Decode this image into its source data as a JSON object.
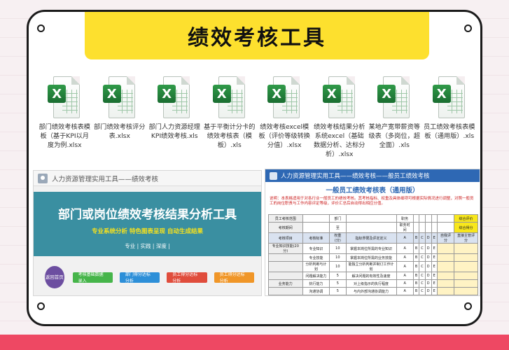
{
  "page": {
    "title": "绩效考核工具"
  },
  "files": [
    {
      "icon": "excel-file-icon",
      "name": "部门绩效考核表模板（基于KPI以月度为例.xlsx"
    },
    {
      "icon": "excel-file-icon",
      "name": "部门绩效考核评分表.xlsx"
    },
    {
      "icon": "excel-file-icon",
      "name": "部门人力资源经理KPI绩效考核.xls"
    },
    {
      "icon": "excel-file-icon",
      "name": "基于平衡计分卡的绩效考核表（模板）.xls"
    },
    {
      "icon": "excel-file-icon",
      "name": "绩效考核excel模板（评价等级转换分值）.xlsx"
    },
    {
      "icon": "excel-file-icon",
      "name": "绩效考核结果分析系统excel（基础数据分析、达标分析）.xlsx"
    },
    {
      "icon": "excel-file-icon",
      "name": "某地产宽带薪资等级表（多岗位，超全面）.xls"
    },
    {
      "icon": "excel-file-icon",
      "name": "员工绩效考核表模板（通用版）.xls"
    }
  ],
  "preview_left": {
    "header": "人力资源管理实用工具——绩效考核",
    "title": "部门或岗位绩效考核结果分析工具",
    "subtitle": "专业系统分析   特色图表呈现   自动生成结果",
    "motto": "专业 | 实践 | 深度 |",
    "home_button": "返回首页",
    "buttons": [
      "考核基础数据录入",
      "部门得分达标分析",
      "员工得分达标分析",
      "员工得分达标分析"
    ]
  },
  "preview_right": {
    "header": "人力资源管理实用工具——绩效考核——般员工绩效考核",
    "table_title": "一般员工绩效考核表（通用版）",
    "description": "说明：本表格适用于对各行业一般员工的绩效考核。其考核指标、权重及具体细项可根据实际情况进行调整，对照一般员工的岗位职责与工作内容评定等级，评价汇总后自动得出相应分值。",
    "rows": [
      [
        "员工考核范围",
        "",
        "部门",
        "",
        "职务",
        "",
        "",
        "",
        "",
        "",
        "综合评价"
      ],
      [
        "考核期间",
        "",
        "至",
        "",
        "职务时间",
        "",
        "",
        "",
        "",
        "",
        "综合得分"
      ],
      [
        "考核项目",
        "考核标准",
        "权重(分)",
        "指标界限及评定定义",
        "A",
        "B",
        "C",
        "D",
        "E",
        "自我评分",
        "直接主管评分"
      ],
      [
        "专业知识技能(20分)",
        "专业知识",
        "10",
        "掌握本岗位所需的专业知识",
        "A",
        "B",
        "C",
        "D",
        "E",
        "",
        ""
      ],
      [
        "",
        "专业技能",
        "10",
        "掌握本岗位所需的业务技能",
        "A",
        "B",
        "C",
        "D",
        "E",
        "",
        ""
      ],
      [
        "",
        "分析判断与计划",
        "10",
        "能独立分析判断并制订工作计划",
        "A",
        "B",
        "C",
        "D",
        "E",
        "",
        ""
      ],
      [
        "",
        "问题解决能力",
        "5",
        "解决问题的有效性及速度",
        "A",
        "B",
        "C",
        "D",
        "E",
        "",
        ""
      ],
      [
        "业务能力",
        "执行能力",
        "5",
        "对上级指示的执行程度",
        "A",
        "B",
        "C",
        "D",
        "E",
        "",
        ""
      ],
      [
        "",
        "沟通协调",
        "5",
        "与内外部沟通协调能力",
        "A",
        "B",
        "C",
        "D",
        "E",
        "",
        ""
      ]
    ]
  }
}
